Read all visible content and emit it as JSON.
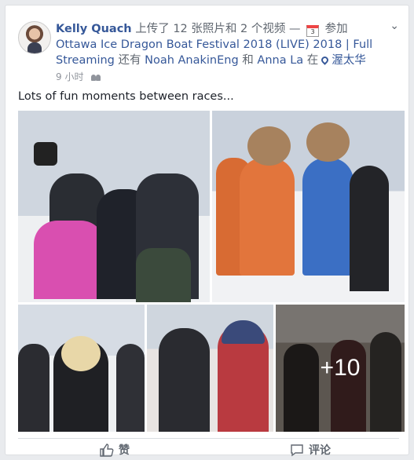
{
  "post": {
    "author": "Kelly Quach",
    "action_text": "上传了 12 张照片和 2 个视频 —",
    "calendar_day": "3",
    "event_prefix": "参加",
    "event_name": "Ottawa Ice Dragon Boat Festival 2018 (LIVE) 2018 | Full Streaming",
    "with_prefix": "还有",
    "tag1": "Noah AnakinEng",
    "and_text": "和",
    "tag2": "Anna La",
    "location_prefix": "在",
    "location": "渥太华",
    "time": "9 小时",
    "text": "Lots of fun moments between races...",
    "more_photos": "+10"
  },
  "actions": {
    "like": "赞",
    "comment": "评论"
  },
  "icons": {
    "calendar": "calendar-icon",
    "location": "pin-icon",
    "audience": "friends-icon",
    "like": "thumbs-up-icon",
    "comment": "speech-bubble-icon",
    "options": "chevron-down-icon"
  },
  "colors": {
    "link": "#365899",
    "meta": "#90949c",
    "background": "#e9ebee"
  }
}
